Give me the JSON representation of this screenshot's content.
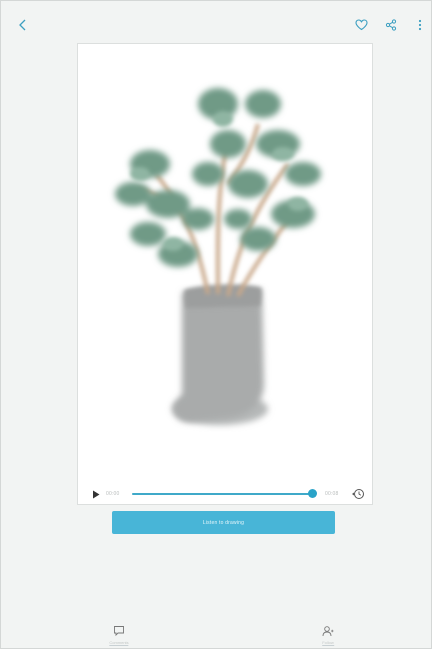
{
  "header": {
    "back_icon": "chevron-left-icon",
    "favorite_icon": "heart-outline-icon",
    "share_icon": "share-icon",
    "more_icon": "more-vertical-icon"
  },
  "player": {
    "play_icon": "play-icon",
    "current_time": "00:00",
    "total_time": "00:08",
    "progress": 0.98,
    "speed_icon": "playback-speed-icon"
  },
  "primary_action": {
    "label": "Listen to drawing"
  },
  "bottom_nav": {
    "items": [
      {
        "icon": "comment-icon",
        "label": "Comments"
      },
      {
        "icon": "user-follow-icon",
        "label": "Follow"
      }
    ]
  },
  "colors": {
    "accent": "#48b5d7",
    "progress": "#2aa3c8",
    "background": "#f2f4f3",
    "icon": "#3d9fc1"
  }
}
